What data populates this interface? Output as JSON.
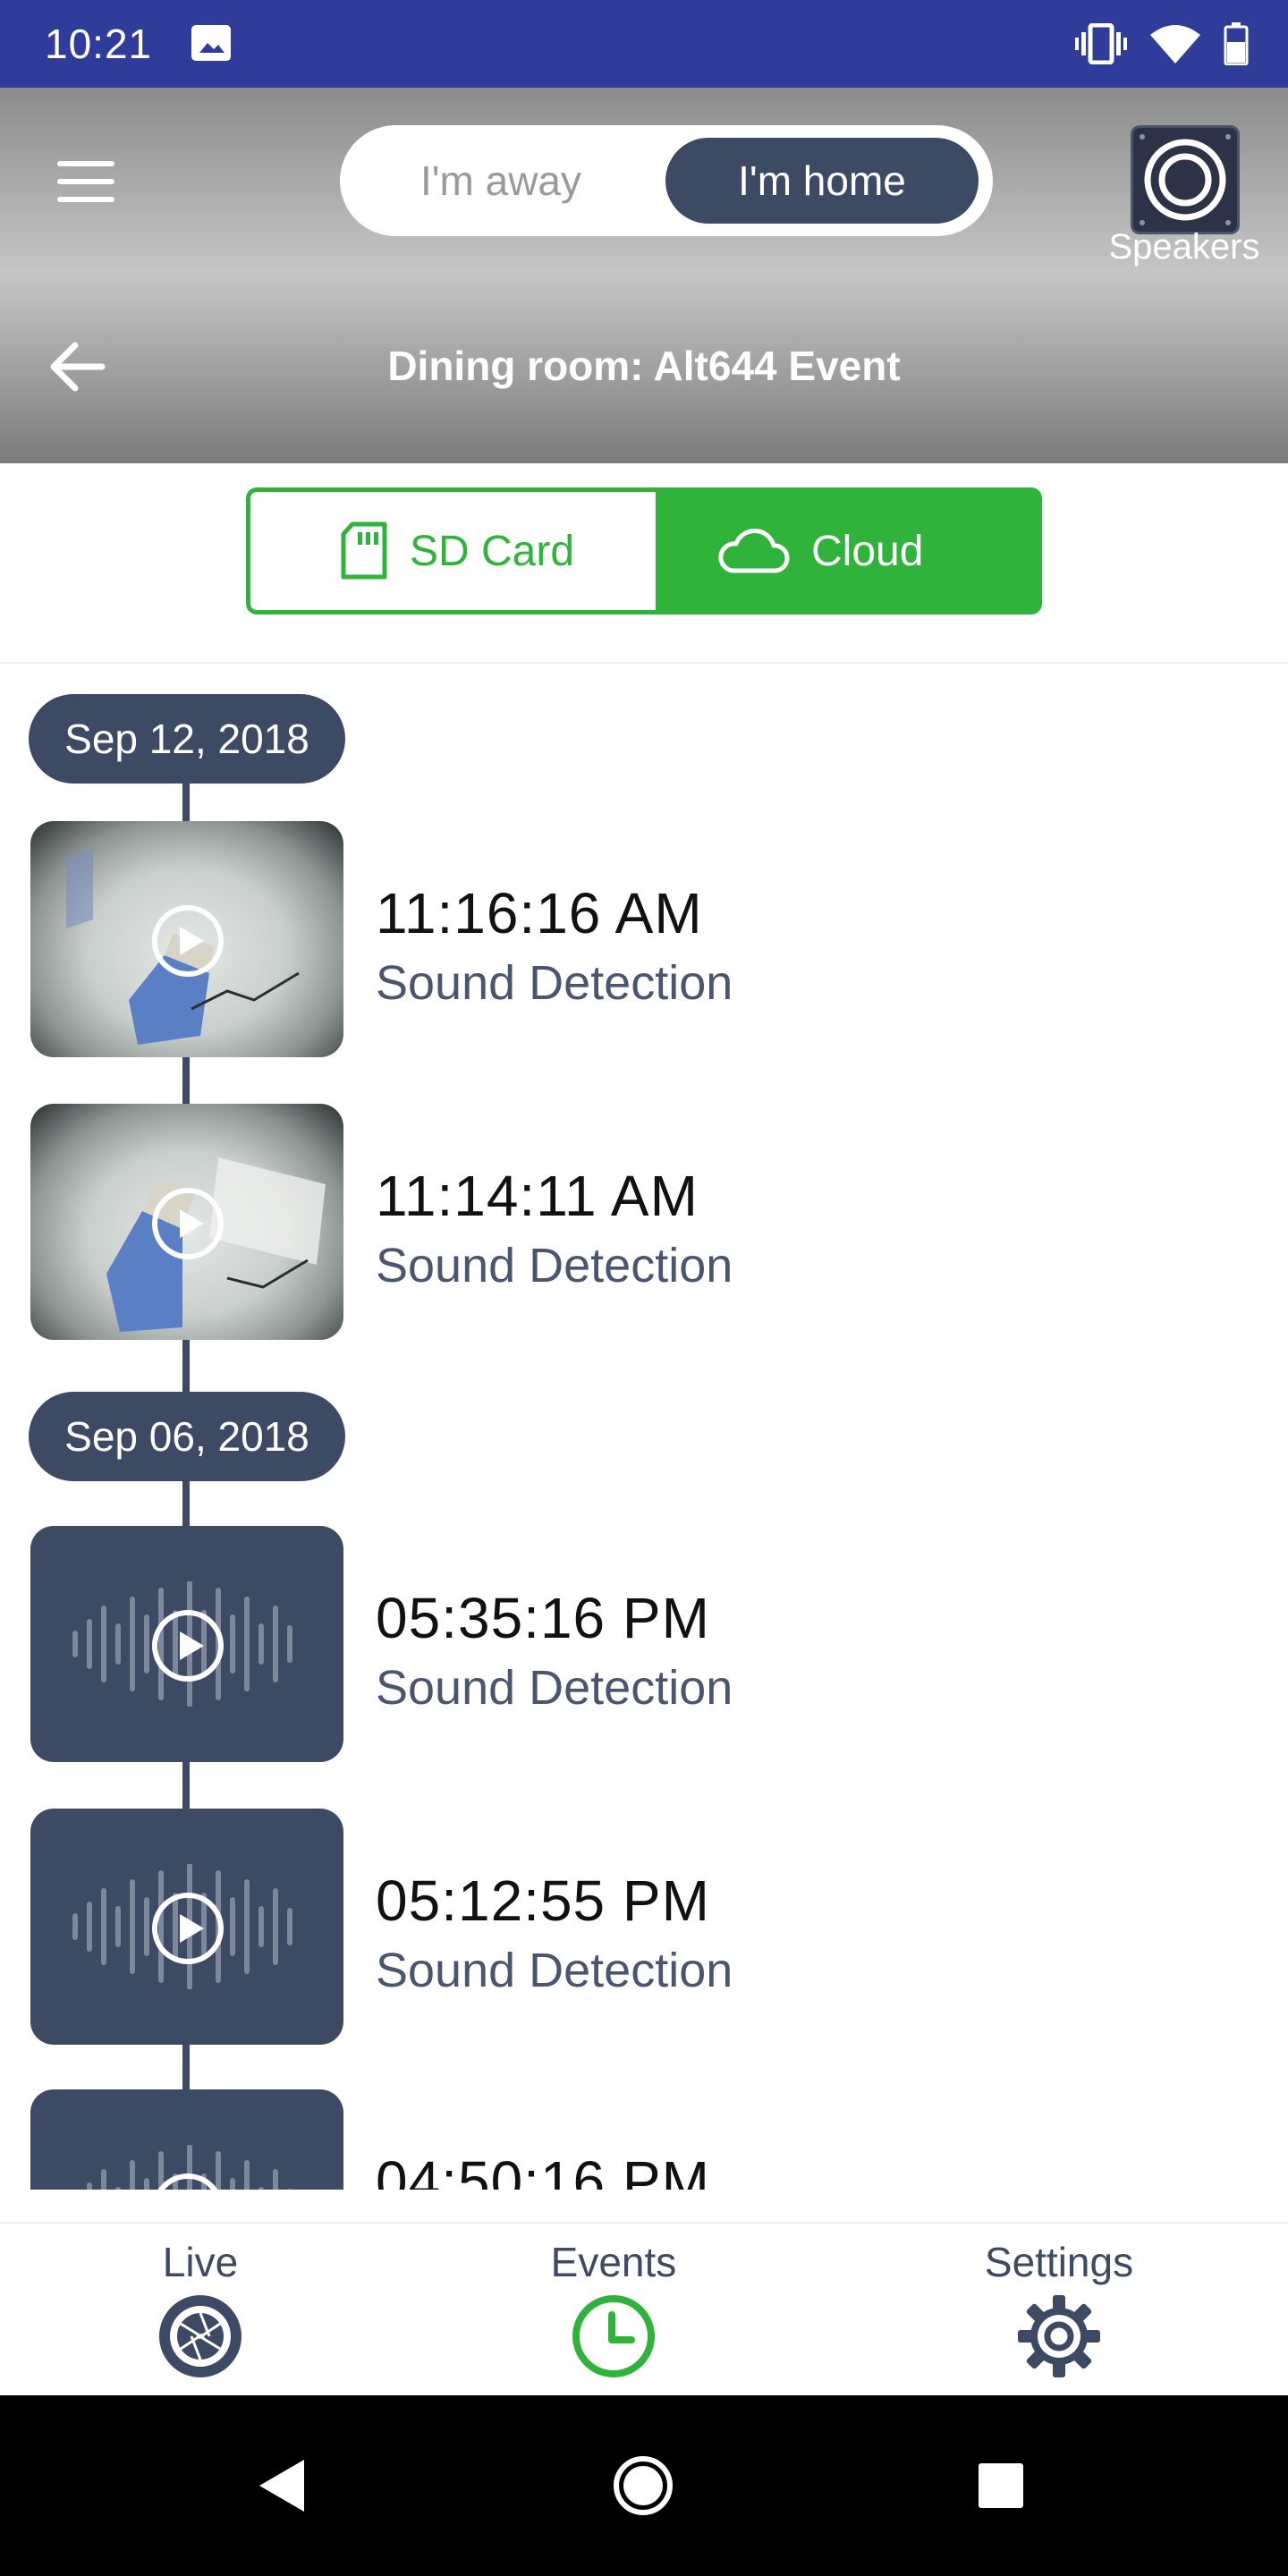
{
  "status_bar": {
    "time": "10:21"
  },
  "header": {
    "mode_away_label": "I'm away",
    "mode_home_label": "I'm home",
    "speakers_label": "Speakers",
    "title": "Dining room: Alt644 Event"
  },
  "source_tabs": {
    "sd_label": "SD Card",
    "cloud_label": "Cloud",
    "selected": "Cloud"
  },
  "events": {
    "groups": [
      {
        "date": "Sep 12, 2018"
      },
      {
        "date": "Sep 06, 2018"
      }
    ],
    "items": [
      {
        "time": "11:16:16 AM",
        "type": "Sound Detection",
        "thumbnail": "camera-snapshot"
      },
      {
        "time": "11:14:11 AM",
        "type": "Sound Detection",
        "thumbnail": "camera-snapshot"
      },
      {
        "time": "05:35:16 PM",
        "type": "Sound Detection",
        "thumbnail": "sound-wave"
      },
      {
        "time": "05:12:55 PM",
        "type": "Sound Detection",
        "thumbnail": "sound-wave"
      },
      {
        "time": "04:50:16 PM",
        "type": "",
        "thumbnail": "sound-wave"
      }
    ]
  },
  "bottom_nav": {
    "live_label": "Live",
    "events_label": "Events",
    "settings_label": "Settings",
    "active": "Events"
  },
  "colors": {
    "status_bar": "#2f3c9a",
    "accent_green": "#2fb33b",
    "slate": "#3d4a63",
    "event_type_text": "#4a5670"
  },
  "icons": {
    "status_left": [
      "image-icon"
    ],
    "status_right": [
      "vibrate-icon",
      "wifi-icon",
      "battery-icon"
    ],
    "system_nav": [
      "back-triangle-icon",
      "home-circle-icon",
      "recents-square-icon"
    ]
  }
}
